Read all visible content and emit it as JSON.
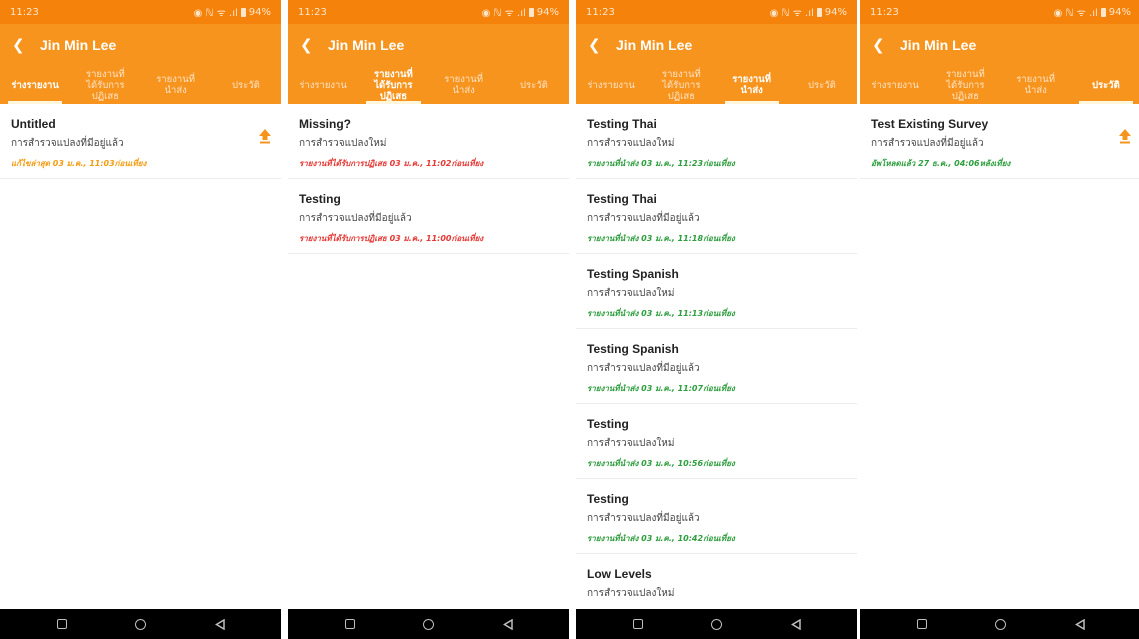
{
  "colors": {
    "appbar": "#f7941e",
    "statusbar": "#f5820a",
    "draft_status": "#f39c12",
    "rejected_status": "#e53935",
    "submitted_status": "#2e9e3e",
    "uploaded_status": "#2e9e3e"
  },
  "screens": [
    {
      "status": {
        "time": "11:23",
        "signal": "◉ ℕ ᯤ .ıl",
        "battery": "94%"
      },
      "appbar": {
        "back_icon": "back-icon",
        "title": "Jin Min Lee"
      },
      "tabs": [
        {
          "lines": [
            "ร่างรายงาน"
          ],
          "active": true
        },
        {
          "lines": [
            "รายงานที่",
            "ได้รับการ",
            "ปฏิเสธ"
          ],
          "active": false
        },
        {
          "lines": [
            "รายงานที่",
            "นำส่ง"
          ],
          "active": false
        },
        {
          "lines": [
            "ประวัติ"
          ],
          "active": false
        }
      ],
      "items": [
        {
          "title": "Untitled",
          "subtitle": "การสำรวจแปลงที่มีอยู่แล้ว",
          "status": "แก้ไขล่าสุด 03 ม.ค., 11:03ก่อนเที่ยง",
          "status_color": "#f39c12",
          "upload": true
        }
      ]
    },
    {
      "status": {
        "time": "11:23",
        "signal": "◉ ℕ ᯤ .ıl",
        "battery": "94%"
      },
      "appbar": {
        "back_icon": "back-icon",
        "title": "Jin Min Lee"
      },
      "tabs": [
        {
          "lines": [
            "ร่างรายงาน"
          ],
          "active": false
        },
        {
          "lines": [
            "รายงานที่",
            "ได้รับการ",
            "ปฏิเสธ"
          ],
          "active": true
        },
        {
          "lines": [
            "รายงานที่",
            "นำส่ง"
          ],
          "active": false
        },
        {
          "lines": [
            "ประวัติ"
          ],
          "active": false
        }
      ],
      "items": [
        {
          "title": "Missing?",
          "subtitle": "การสำรวจแปลงใหม่",
          "status": "รายงานที่ได้รับการปฏิเสธ 03 ม.ค., 11:02ก่อนเที่ยง",
          "status_color": "#e53935",
          "upload": false
        },
        {
          "title": "Testing",
          "subtitle": "การสำรวจแปลงที่มีอยู่แล้ว",
          "status": "รายงานที่ได้รับการปฏิเสธ 03 ม.ค., 11:00ก่อนเที่ยง",
          "status_color": "#e53935",
          "upload": false
        }
      ]
    },
    {
      "status": {
        "time": "11:23",
        "signal": "◉ ℕ ᯤ .ıl",
        "battery": "94%"
      },
      "appbar": {
        "back_icon": "back-icon",
        "title": "Jin Min Lee"
      },
      "tabs": [
        {
          "lines": [
            "ร่างรายงาน"
          ],
          "active": false
        },
        {
          "lines": [
            "รายงานที่",
            "ได้รับการ",
            "ปฏิเสธ"
          ],
          "active": false
        },
        {
          "lines": [
            "รายงานที่",
            "นำส่ง"
          ],
          "active": true
        },
        {
          "lines": [
            "ประวัติ"
          ],
          "active": false
        }
      ],
      "items": [
        {
          "title": "Testing Thai",
          "subtitle": "การสำรวจแปลงใหม่",
          "status": "รายงานที่นำส่ง 03 ม.ค., 11:23ก่อนเที่ยง",
          "status_color": "#2e9e3e",
          "upload": false
        },
        {
          "title": "Testing Thai",
          "subtitle": "การสำรวจแปลงที่มีอยู่แล้ว",
          "status": "รายงานที่นำส่ง 03 ม.ค., 11:18ก่อนเที่ยง",
          "status_color": "#2e9e3e",
          "upload": false
        },
        {
          "title": "Testing Spanish",
          "subtitle": "การสำรวจแปลงใหม่",
          "status": "รายงานที่นำส่ง 03 ม.ค., 11:13ก่อนเที่ยง",
          "status_color": "#2e9e3e",
          "upload": false
        },
        {
          "title": "Testing Spanish",
          "subtitle": "การสำรวจแปลงที่มีอยู่แล้ว",
          "status": "รายงานที่นำส่ง 03 ม.ค., 11:07ก่อนเที่ยง",
          "status_color": "#2e9e3e",
          "upload": false
        },
        {
          "title": "Testing",
          "subtitle": "การสำรวจแปลงใหม่",
          "status": "รายงานที่นำส่ง 03 ม.ค., 10:56ก่อนเที่ยง",
          "status_color": "#2e9e3e",
          "upload": false
        },
        {
          "title": "Testing",
          "subtitle": "การสำรวจแปลงที่มีอยู่แล้ว",
          "status": "รายงานที่นำส่ง 03 ม.ค., 10:42ก่อนเที่ยง",
          "status_color": "#2e9e3e",
          "upload": false
        },
        {
          "title": "Low Levels",
          "subtitle": "การสำรวจแปลงใหม่",
          "status": "",
          "status_color": "#2e9e3e",
          "upload": false
        }
      ]
    },
    {
      "status": {
        "time": "11:23",
        "signal": "◉ ℕ ᯤ .ıl",
        "battery": "94%"
      },
      "appbar": {
        "back_icon": "back-icon",
        "title": "Jin Min Lee"
      },
      "tabs": [
        {
          "lines": [
            "ร่างรายงาน"
          ],
          "active": false
        },
        {
          "lines": [
            "รายงานที่",
            "ได้รับการ",
            "ปฏิเสธ"
          ],
          "active": false
        },
        {
          "lines": [
            "รายงานที่",
            "นำส่ง"
          ],
          "active": false
        },
        {
          "lines": [
            "ประวัติ"
          ],
          "active": true
        }
      ],
      "items": [
        {
          "title": "Test Existing Survey",
          "subtitle": "การสำรวจแปลงที่มีอยู่แล้ว",
          "status": "อัพโหลดแล้ว 27 ธ.ค., 04:06หลังเที่ยง",
          "status_color": "#2e9e3e",
          "upload": true
        }
      ]
    }
  ]
}
